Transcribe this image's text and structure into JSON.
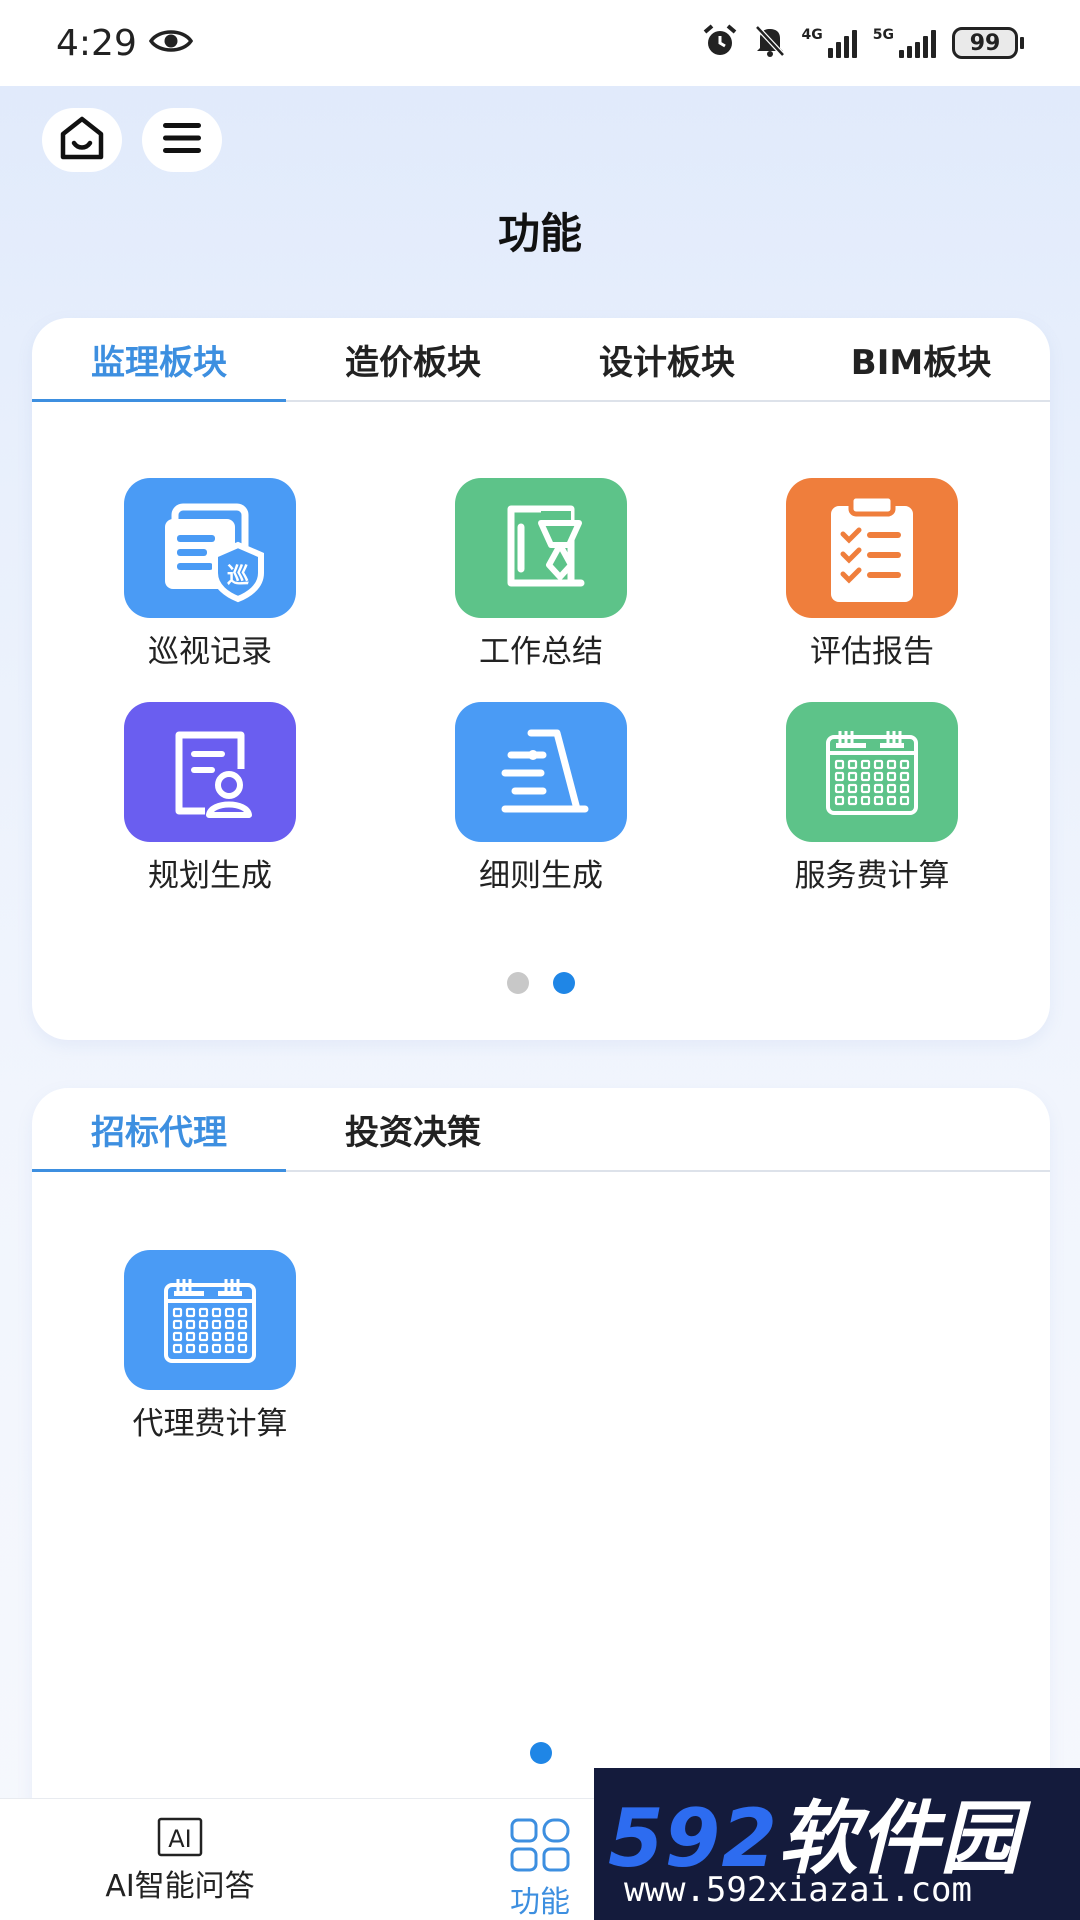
{
  "status_bar": {
    "time": "4:29",
    "network_1": "4G",
    "network_2": "5G",
    "battery": "99"
  },
  "page": {
    "title": "功能"
  },
  "card1": {
    "tabs": [
      {
        "label": "监理板块",
        "active": true
      },
      {
        "label": "造价板块",
        "active": false
      },
      {
        "label": "设计板块",
        "active": false
      },
      {
        "label": "BIM板块",
        "active": false
      }
    ],
    "items": [
      {
        "label": "巡视记录",
        "icon": "patrol-record-icon",
        "color": "#4a9bf5"
      },
      {
        "label": "工作总结",
        "icon": "work-summary-icon",
        "color": "#5dc389"
      },
      {
        "label": "评估报告",
        "icon": "clipboard-checklist-icon",
        "color": "#ef7e3c"
      },
      {
        "label": "规划生成",
        "icon": "document-person-icon",
        "color": "#6a5ef0"
      },
      {
        "label": "细则生成",
        "icon": "rules-document-icon",
        "color": "#4a9bf5"
      },
      {
        "label": "服务费计算",
        "icon": "calendar-grid-icon",
        "color": "#5dc389"
      }
    ],
    "pages": 2,
    "active_page": 2
  },
  "card2": {
    "tabs": [
      {
        "label": "招标代理",
        "active": true
      },
      {
        "label": "投资决策",
        "active": false
      }
    ],
    "items": [
      {
        "label": "代理费计算",
        "icon": "calendar-grid-icon",
        "color": "#4a9bf5"
      }
    ],
    "pages": 1,
    "active_page": 1
  },
  "bottom_nav": {
    "items": [
      {
        "label": "AI智能问答",
        "icon": "ai-box-icon",
        "active": false
      },
      {
        "label": "功能",
        "icon": "grid-apps-icon",
        "active": true
      }
    ]
  },
  "watermark": {
    "number": "592",
    "brand": "软件园",
    "url": "www.592xiazai.com"
  }
}
